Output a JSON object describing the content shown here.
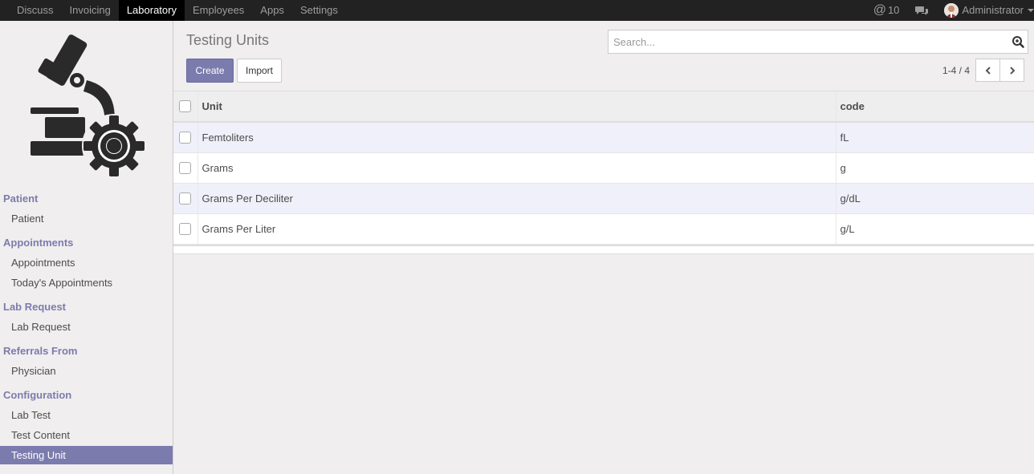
{
  "topbar": {
    "menu": [
      "Discuss",
      "Invoicing",
      "Laboratory",
      "Employees",
      "Apps",
      "Settings"
    ],
    "active_menu": "Laboratory",
    "notifications_count": "10",
    "user_name": "Administrator"
  },
  "sidebar": {
    "logo_icon": "microscope-gear-icon",
    "sections": [
      {
        "title": "Patient",
        "items": [
          "Patient"
        ]
      },
      {
        "title": "Appointments",
        "items": [
          "Appointments",
          "Today's Appointments"
        ]
      },
      {
        "title": "Lab Request",
        "items": [
          "Lab Request"
        ]
      },
      {
        "title": "Referrals From",
        "items": [
          "Physician"
        ]
      },
      {
        "title": "Configuration",
        "items": [
          "Lab Test",
          "Test Content",
          "Testing Unit"
        ]
      }
    ],
    "active_item": "Testing Unit"
  },
  "control_panel": {
    "title": "Testing Units",
    "search_placeholder": "Search...",
    "create_label": "Create",
    "import_label": "Import",
    "pager": "1-4 / 4"
  },
  "table": {
    "columns": [
      "Unit",
      "code"
    ],
    "rows": [
      [
        "Femtoliters",
        "fL"
      ],
      [
        "Grams",
        "g"
      ],
      [
        "Grams Per Deciliter",
        "g/dL"
      ],
      [
        "Grams Per Liter",
        "g/L"
      ]
    ]
  },
  "colors": {
    "accent": "#7c7bad",
    "topbar": "#222222",
    "background": "#f0eeee"
  }
}
